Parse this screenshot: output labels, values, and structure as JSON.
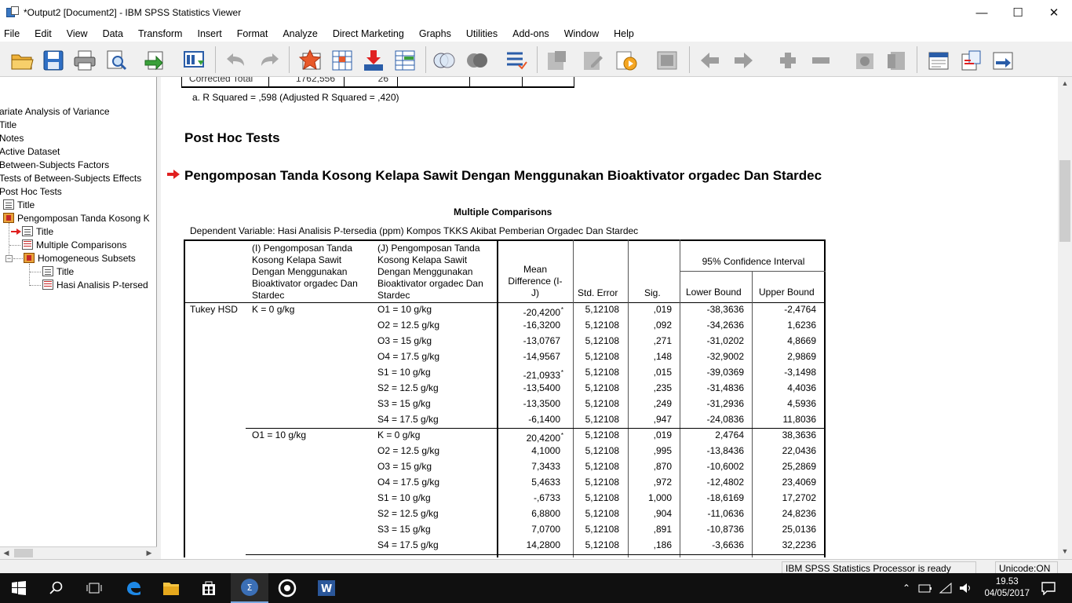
{
  "window": {
    "title": "*Output2 [Document2] - IBM SPSS Statistics Viewer",
    "minimize": "—",
    "maximize": "☐",
    "close": "✕"
  },
  "menu": [
    "File",
    "Edit",
    "View",
    "Data",
    "Transform",
    "Insert",
    "Format",
    "Analyze",
    "Direct Marketing",
    "Graphs",
    "Utilities",
    "Add-ons",
    "Window",
    "Help"
  ],
  "outline": {
    "items": [
      "ariate Analysis of Variance",
      "Title",
      "Notes",
      "Active Dataset",
      "Between-Subjects Factors",
      "Tests of Between-Subjects Effects",
      "Post Hoc Tests",
      "Title",
      "Pengomposan Tanda Kosong K",
      "Title",
      "Multiple Comparisons",
      "Homogeneous Subsets",
      "Title",
      "Hasi Analisis P-tersed"
    ]
  },
  "content": {
    "prev_table_row": {
      "label": "Corrected Total",
      "value": "1762,556",
      "df": "26"
    },
    "footnote": "a. R Squared = ,598 (Adjusted R Squared = ,420)",
    "post_hoc_heading": "Post Hoc Tests",
    "section_heading": "Pengomposan Tanda Kosong Kelapa Sawit Dengan Menggunakan Bioaktivator orgadec Dan Stardec",
    "table_title": "Multiple Comparisons",
    "dependent_variable": "Dependent Variable:   Hasi Analisis P-tersedia (ppm) Kompos TKKS Akibat Pemberian Orgadec Dan Stardec",
    "headers": {
      "i": [
        "(I) Pengomposan Tanda",
        "Kosong Kelapa Sawit",
        "Dengan Menggunakan",
        "Bioaktivator orgadec Dan",
        "Stardec"
      ],
      "j": [
        "(J) Pengomposan Tanda",
        "Kosong Kelapa Sawit",
        "Dengan Menggunakan",
        "Bioaktivator orgadec Dan",
        "Stardec"
      ],
      "mean_diff": [
        "Mean",
        "Difference (I-",
        "J)"
      ],
      "std_error": "Std. Error",
      "sig": "Sig.",
      "ci": "95% Confidence Interval",
      "lower": "Lower Bound",
      "upper": "Upper Bound"
    },
    "method": "Tukey HSD",
    "groups": [
      {
        "i": "K = 0 g/kg",
        "rows": [
          [
            "O1 = 10 g/kg",
            "-20,4200",
            "*",
            "5,12108",
            ",019",
            "-38,3636",
            "-2,4764"
          ],
          [
            "O2 = 12.5 g/kg",
            "-16,3200",
            "",
            "5,12108",
            ",092",
            "-34,2636",
            "1,6236"
          ],
          [
            "O3 = 15 g/kg",
            "-13,0767",
            "",
            "5,12108",
            ",271",
            "-31,0202",
            "4,8669"
          ],
          [
            "O4 = 17.5 g/kg",
            "-14,9567",
            "",
            "5,12108",
            ",148",
            "-32,9002",
            "2,9869"
          ],
          [
            "S1 = 10 g/kg",
            "-21,0933",
            "*",
            "5,12108",
            ",015",
            "-39,0369",
            "-3,1498"
          ],
          [
            "S2 = 12.5 g/kg",
            "-13,5400",
            "",
            "5,12108",
            ",235",
            "-31,4836",
            "4,4036"
          ],
          [
            "S3 = 15 g/kg",
            "-13,3500",
            "",
            "5,12108",
            ",249",
            "-31,2936",
            "4,5936"
          ],
          [
            "S4 = 17.5 g/kg",
            "-6,1400",
            "",
            "5,12108",
            ",947",
            "-24,0836",
            "11,8036"
          ]
        ]
      },
      {
        "i": "O1 = 10 g/kg",
        "rows": [
          [
            "K = 0 g/kg",
            "20,4200",
            "*",
            "5,12108",
            ",019",
            "2,4764",
            "38,3636"
          ],
          [
            "O2 = 12.5 g/kg",
            "4,1000",
            "",
            "5,12108",
            ",995",
            "-13,8436",
            "22,0436"
          ],
          [
            "O3 = 15 g/kg",
            "7,3433",
            "",
            "5,12108",
            ",870",
            "-10,6002",
            "25,2869"
          ],
          [
            "O4 = 17.5 g/kg",
            "5,4633",
            "",
            "5,12108",
            ",972",
            "-12,4802",
            "23,4069"
          ],
          [
            "S1 = 10 g/kg",
            "-,6733",
            "",
            "5,12108",
            "1,000",
            "-18,6169",
            "17,2702"
          ],
          [
            "S2 = 12.5 g/kg",
            "6,8800",
            "",
            "5,12108",
            ",904",
            "-11,0636",
            "24,8236"
          ],
          [
            "S3 = 15 g/kg",
            "7,0700",
            "",
            "5,12108",
            ",891",
            "-10,8736",
            "25,0136"
          ],
          [
            "S4 = 17.5 g/kg",
            "14,2800",
            "",
            "5,12108",
            ",186",
            "-3,6636",
            "32,2236"
          ]
        ]
      }
    ]
  },
  "status": {
    "processor": "IBM SPSS Statistics Processor is ready",
    "unicode": "Unicode:ON"
  },
  "taskbar": {
    "time": "19.53",
    "date": "04/05/2017"
  },
  "colors": {
    "accent_red": "#e02020",
    "taskbar": "#101010"
  }
}
